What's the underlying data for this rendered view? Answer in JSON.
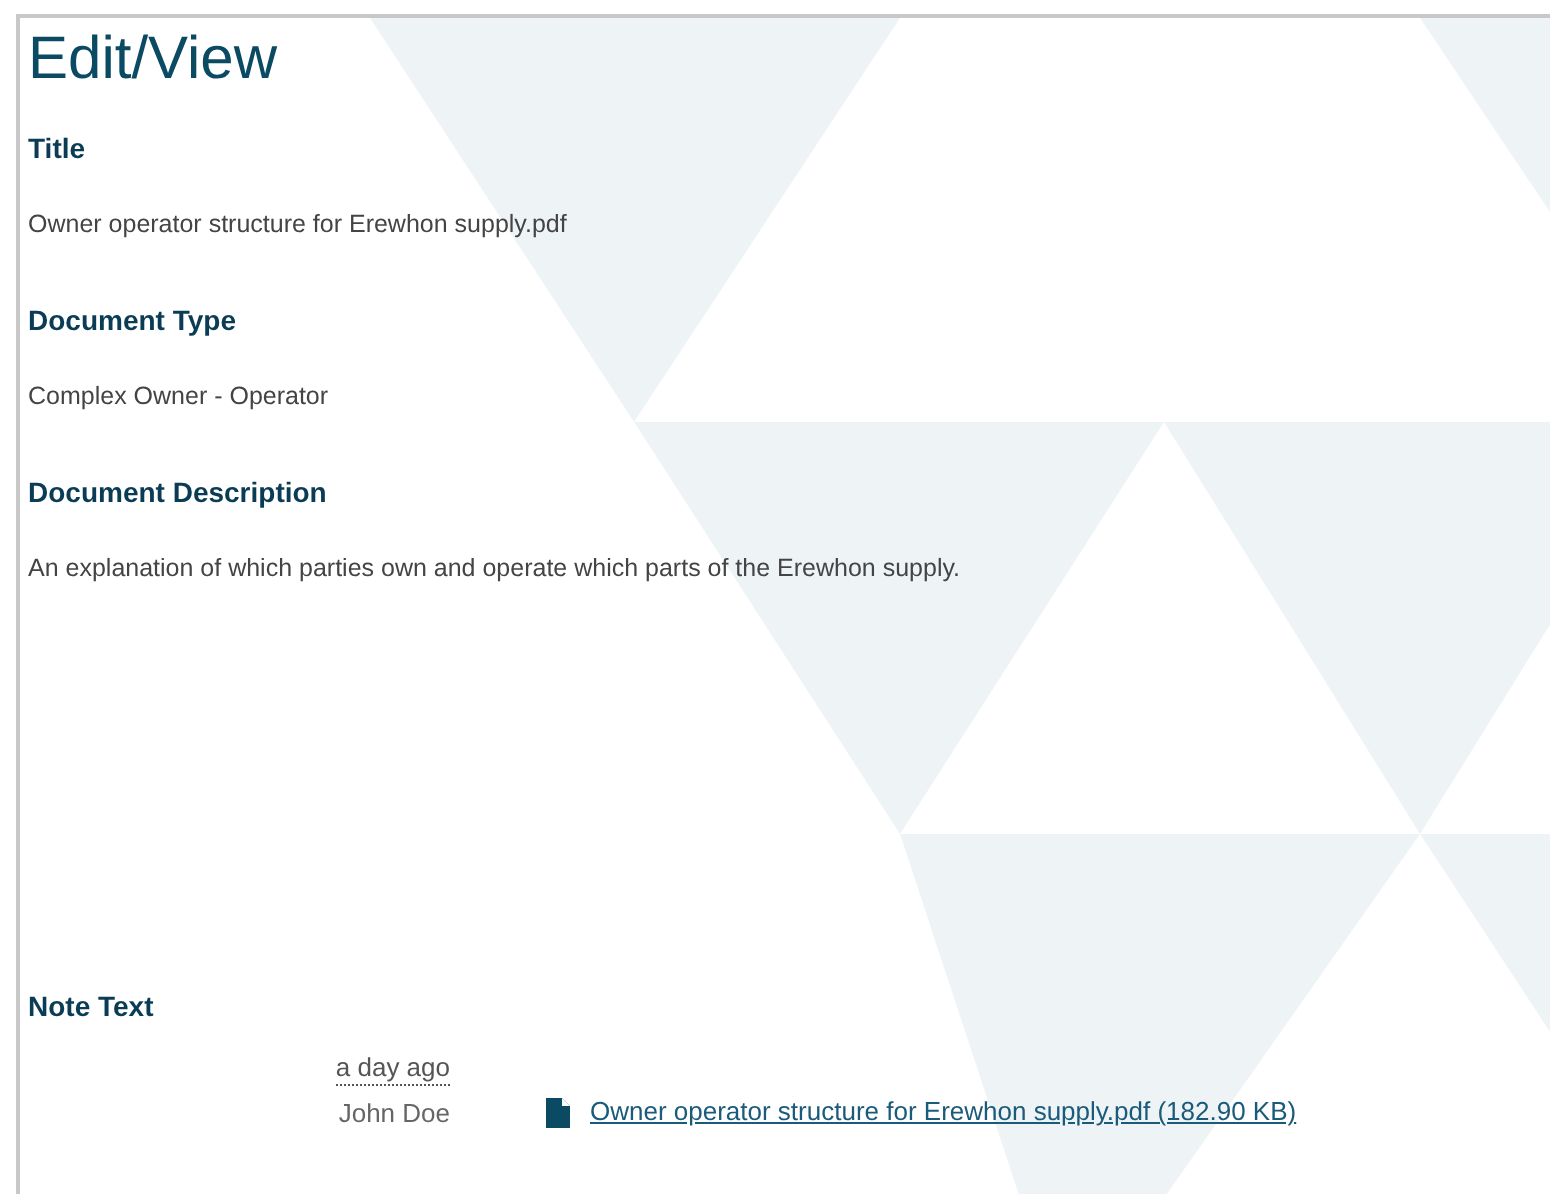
{
  "heading": "Edit/View",
  "fields": [
    {
      "label": "Title",
      "value": "Owner operator structure for Erewhon supply.pdf"
    },
    {
      "label": "Document Type",
      "value": "Complex Owner - Operator"
    },
    {
      "label": "Document Description",
      "value": "An explanation of which parties own and operate which parts of the Erewhon supply."
    }
  ],
  "note": {
    "label": "Note Text",
    "time": "a day ago",
    "author": "John Doe",
    "attachment": "Owner operator structure for Erewhon supply.pdf (182.90 KB)"
  }
}
